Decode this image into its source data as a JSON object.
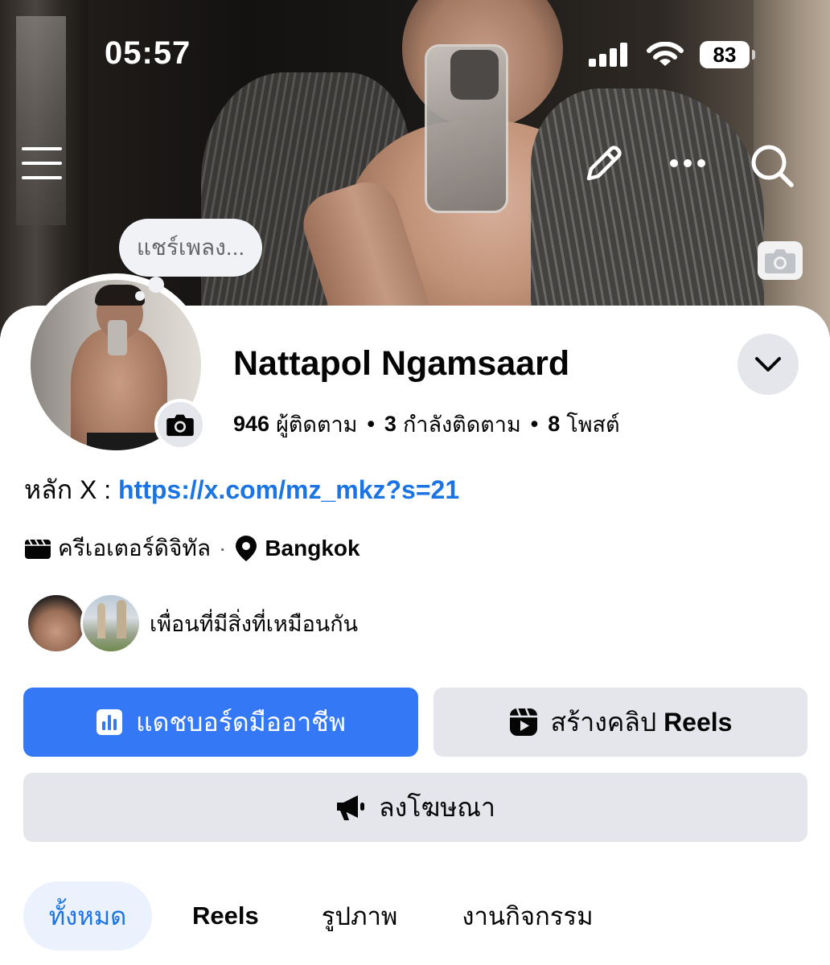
{
  "status_bar": {
    "time": "05:57",
    "battery": "83",
    "icons": [
      "cellular-signal-icon",
      "wifi-icon",
      "battery-icon"
    ]
  },
  "header": {
    "icons": [
      "menu-icon",
      "edit-pencil-icon",
      "more-icon",
      "search-icon",
      "camera-icon"
    ]
  },
  "profile": {
    "music_bubble": "แชร์เพลง...",
    "name": "Nattapol Ngamsaard",
    "stats": {
      "followers_count": "946",
      "followers_label": "ผู้ติดตาม",
      "following_count": "3",
      "following_label": "กำลังติดตาม",
      "posts_count": "8",
      "posts_label": "โพสต์"
    },
    "bio_prefix": "หลัก X : ",
    "bio_link": "https://x.com/mz_mkz?s=21",
    "category": "ครีเอเตอร์ดิจิทัล",
    "separator": "·",
    "location": "Bangkok",
    "mutual_text": "เพื่อนที่มีสิ่งที่เหมือนกัน"
  },
  "actions": {
    "dashboard_label": "แดชบอร์ดมืออาชีพ",
    "reels_prefix": "สร้างคลิป",
    "reels_word": "Reels",
    "ads_label": "ลงโฆษณา"
  },
  "tabs": [
    {
      "label": "ทั้งหมด",
      "active": true
    },
    {
      "label": "Reels",
      "active": false
    },
    {
      "label": "รูปภาพ",
      "active": false
    },
    {
      "label": "งานกิจกรรม",
      "active": false
    }
  ],
  "colors": {
    "accent": "#3578f5",
    "link": "#1b74e4",
    "button_gray": "#e4e6eb",
    "tab_active_bg": "#ebf2fe"
  }
}
